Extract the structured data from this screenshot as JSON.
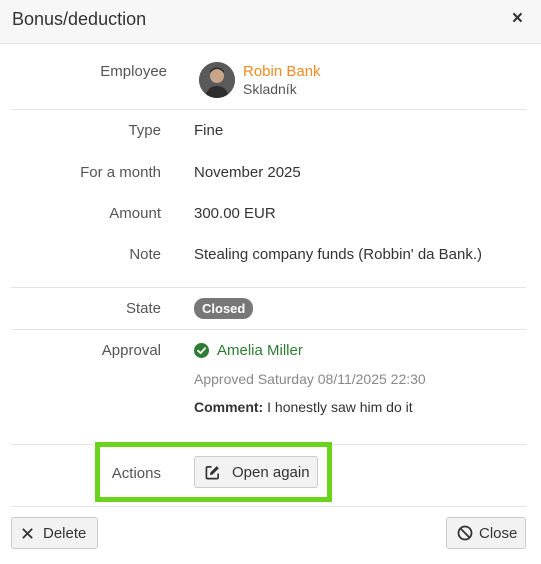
{
  "dialog": {
    "title": "Bonus/deduction",
    "close_symbol": "×"
  },
  "employee": {
    "label": "Employee",
    "name": "Robin Bank",
    "role": "Skladník",
    "avatar_icon": "person-avatar"
  },
  "fields": {
    "type_label": "Type",
    "type_value": "Fine",
    "month_label": "For a month",
    "month_value": "November 2025",
    "amount_label": "Amount",
    "amount_value": "300.00 EUR",
    "note_label": "Note",
    "note_value": "Stealing company funds (Robbin' da Bank.)"
  },
  "state": {
    "label": "State",
    "badge": "Closed",
    "badge_color": "#777777"
  },
  "approval": {
    "label": "Approval",
    "approver": "Amelia Miller",
    "approved_text": "Approved Saturday 08/11/2025 22:30",
    "comment_label": "Comment:",
    "comment_text": "I honestly saw him do it",
    "status_icon": "check-circle",
    "status_color": "#2e7d32"
  },
  "actions": {
    "label": "Actions",
    "open_again": "Open again",
    "highlight_color": "#6cd31c"
  },
  "footer": {
    "delete": "Delete",
    "close": "Close"
  },
  "colors": {
    "employee_name": "#f08a24"
  }
}
